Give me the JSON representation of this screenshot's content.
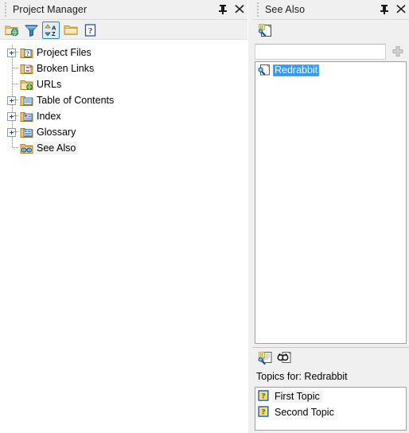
{
  "project_manager": {
    "title": "Project Manager",
    "pin_tooltip": "Auto Hide",
    "close_tooltip": "Close",
    "toolbar": [
      {
        "name": "folder-globe-icon",
        "label": "Project Files"
      },
      {
        "name": "filter-funnel-icon",
        "label": "Filter"
      },
      {
        "name": "sort-az-icon",
        "label": "Sort A-Z",
        "active": true
      },
      {
        "name": "folder-icon",
        "label": "New Folder"
      },
      {
        "name": "help-icon",
        "label": "Help"
      }
    ],
    "tree": [
      {
        "label": "Project Files",
        "icon": "project-files-icon",
        "expander": "plus",
        "selected": false
      },
      {
        "label": "Broken Links",
        "icon": "broken-links-icon",
        "expander": "none",
        "selected": false
      },
      {
        "label": "URLs",
        "icon": "urls-icon",
        "expander": "none",
        "selected": false
      },
      {
        "label": "Table of Contents",
        "icon": "table-of-contents-icon",
        "expander": "plus",
        "selected": false
      },
      {
        "label": "Index",
        "icon": "index-icon",
        "expander": "plus",
        "selected": false
      },
      {
        "label": "Glossary",
        "icon": "glossary-icon",
        "expander": "plus",
        "selected": false
      },
      {
        "label": "See Also",
        "icon": "see-also-icon",
        "expander": "none",
        "selected": true
      }
    ]
  },
  "see_also": {
    "title": "See Also",
    "toolbar": [
      {
        "name": "new-see-also-icon",
        "label": "New See Also Keyword"
      }
    ],
    "input": {
      "value": "",
      "placeholder": ""
    },
    "add_button": {
      "name": "add-icon",
      "label": "Add",
      "enabled": false
    },
    "items": [
      {
        "label": "Redrabbit",
        "icon": "see-also-keyword-icon",
        "selected": true
      }
    ]
  },
  "topics_pane": {
    "toolbar": [
      {
        "name": "new-topic-icon",
        "label": "New Topic"
      },
      {
        "name": "find-topic-icon",
        "label": "Find Topic"
      }
    ],
    "caption": "Topics for: Redrabbit",
    "items": [
      {
        "label": "First Topic",
        "icon": "help-topic-icon",
        "selected": true
      },
      {
        "label": "Second Topic",
        "icon": "help-topic-icon",
        "selected": false
      }
    ]
  },
  "colors": {
    "chrome": "#f0f0f0",
    "selection_blue": "#3399ff",
    "focus_outline": "#f5a623",
    "active_tool_border": "#3c7fb1",
    "list_border": "#a0a0a0"
  }
}
